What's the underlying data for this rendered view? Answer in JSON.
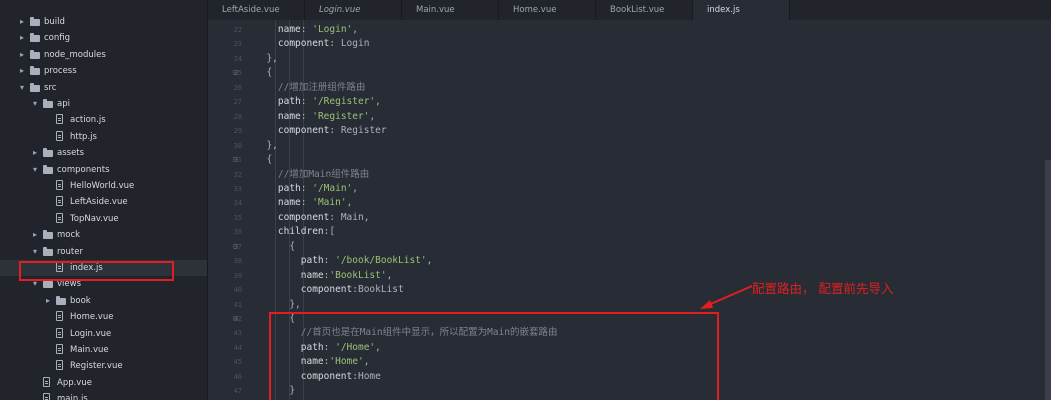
{
  "tree": [
    {
      "label": "build",
      "kind": "folder",
      "arrow": "collapsed",
      "depth": 0
    },
    {
      "label": "config",
      "kind": "folder",
      "arrow": "collapsed",
      "depth": 0
    },
    {
      "label": "node_modules",
      "kind": "folder",
      "arrow": "collapsed",
      "depth": 0
    },
    {
      "label": "process",
      "kind": "folder",
      "arrow": "collapsed",
      "depth": 0
    },
    {
      "label": "src",
      "kind": "folder",
      "arrow": "expanded",
      "depth": 0
    },
    {
      "label": "api",
      "kind": "folder",
      "arrow": "expanded",
      "depth": 1
    },
    {
      "label": "action.js",
      "kind": "file",
      "depth": 2
    },
    {
      "label": "http.js",
      "kind": "file",
      "depth": 2
    },
    {
      "label": "assets",
      "kind": "folder",
      "arrow": "collapsed",
      "depth": 1
    },
    {
      "label": "components",
      "kind": "folder",
      "arrow": "expanded",
      "depth": 1
    },
    {
      "label": "HelloWorld.vue",
      "kind": "file",
      "depth": 2
    },
    {
      "label": "LeftAside.vue",
      "kind": "file",
      "depth": 2
    },
    {
      "label": "TopNav.vue",
      "kind": "file",
      "depth": 2
    },
    {
      "label": "mock",
      "kind": "folder",
      "arrow": "collapsed",
      "depth": 1
    },
    {
      "label": "router",
      "kind": "folder",
      "arrow": "expanded",
      "depth": 1
    },
    {
      "label": "index.js",
      "kind": "file",
      "depth": 2,
      "selected": true
    },
    {
      "label": "views",
      "kind": "folder",
      "arrow": "expanded",
      "depth": 1
    },
    {
      "label": "book",
      "kind": "folder",
      "arrow": "collapsed",
      "depth": 2
    },
    {
      "label": "Home.vue",
      "kind": "file",
      "depth": 2
    },
    {
      "label": "Login.vue",
      "kind": "file",
      "depth": 2
    },
    {
      "label": "Main.vue",
      "kind": "file",
      "depth": 2
    },
    {
      "label": "Register.vue",
      "kind": "file",
      "depth": 2
    },
    {
      "label": "App.vue",
      "kind": "file",
      "depth": 1
    },
    {
      "label": "main.js",
      "kind": "file",
      "depth": 1
    }
  ],
  "tabs": [
    {
      "label": "LeftAside.vue",
      "italic": false,
      "active": false
    },
    {
      "label": "Login.vue",
      "italic": true,
      "active": false
    },
    {
      "label": "Main.vue",
      "italic": false,
      "active": false
    },
    {
      "label": "Home.vue",
      "italic": false,
      "active": false
    },
    {
      "label": "BookList.vue",
      "italic": false,
      "active": false
    },
    {
      "label": "index.js",
      "italic": false,
      "active": true
    }
  ],
  "lines": [
    {
      "n": "22",
      "fold": "",
      "tokens": [
        [
          "    ",
          "d"
        ],
        [
          "name",
          "k"
        ],
        [
          ": ",
          "p"
        ],
        [
          "'Login'",
          "s"
        ],
        [
          ",",
          "p"
        ]
      ]
    },
    {
      "n": "23",
      "fold": "",
      "tokens": [
        [
          "    ",
          "d"
        ],
        [
          "component",
          "k"
        ],
        [
          ": Login",
          "p"
        ]
      ]
    },
    {
      "n": "24",
      "fold": "",
      "tokens": [
        [
          "  },",
          "p"
        ]
      ]
    },
    {
      "n": "25",
      "fold": "⊟",
      "tokens": [
        [
          "  {",
          "p"
        ]
      ]
    },
    {
      "n": "26",
      "fold": "",
      "tokens": [
        [
          "    ",
          "d"
        ],
        [
          "//增加注册组件路由",
          "c"
        ]
      ]
    },
    {
      "n": "27",
      "fold": "",
      "tokens": [
        [
          "    ",
          "d"
        ],
        [
          "path",
          "k"
        ],
        [
          ": ",
          "p"
        ],
        [
          "'/Register'",
          "s"
        ],
        [
          ",",
          "p"
        ]
      ]
    },
    {
      "n": "28",
      "fold": "",
      "tokens": [
        [
          "    ",
          "d"
        ],
        [
          "name",
          "k"
        ],
        [
          ": ",
          "p"
        ],
        [
          "'Register'",
          "s"
        ],
        [
          ",",
          "p"
        ]
      ]
    },
    {
      "n": "29",
      "fold": "",
      "tokens": [
        [
          "    ",
          "d"
        ],
        [
          "component",
          "k"
        ],
        [
          ": Register",
          "p"
        ]
      ]
    },
    {
      "n": "30",
      "fold": "",
      "tokens": [
        [
          "  },",
          "p"
        ]
      ]
    },
    {
      "n": "31",
      "fold": "⊟",
      "tokens": [
        [
          "  {",
          "p"
        ]
      ]
    },
    {
      "n": "32",
      "fold": "",
      "tokens": [
        [
          "    ",
          "d"
        ],
        [
          "//增加Main组件路由",
          "c"
        ]
      ]
    },
    {
      "n": "33",
      "fold": "",
      "tokens": [
        [
          "    ",
          "d"
        ],
        [
          "path",
          "k"
        ],
        [
          ": ",
          "p"
        ],
        [
          "'/Main'",
          "s"
        ],
        [
          ",",
          "p"
        ]
      ]
    },
    {
      "n": "34",
      "fold": "",
      "tokens": [
        [
          "    ",
          "d"
        ],
        [
          "name",
          "k"
        ],
        [
          ": ",
          "p"
        ],
        [
          "'Main'",
          "s"
        ],
        [
          ",",
          "p"
        ]
      ]
    },
    {
      "n": "35",
      "fold": "",
      "tokens": [
        [
          "    ",
          "d"
        ],
        [
          "component",
          "k"
        ],
        [
          ": Main,",
          "p"
        ]
      ]
    },
    {
      "n": "36",
      "fold": "",
      "tokens": [
        [
          "    ",
          "d"
        ],
        [
          "children",
          "k"
        ],
        [
          ":[",
          "p"
        ]
      ]
    },
    {
      "n": "37",
      "fold": "⊟",
      "tokens": [
        [
          "      {",
          "p"
        ]
      ]
    },
    {
      "n": "38",
      "fold": "",
      "tokens": [
        [
          "        ",
          "d"
        ],
        [
          "path",
          "k"
        ],
        [
          ": ",
          "p"
        ],
        [
          "'/book/BookList'",
          "s"
        ],
        [
          ",",
          "p"
        ]
      ]
    },
    {
      "n": "39",
      "fold": "",
      "tokens": [
        [
          "        ",
          "d"
        ],
        [
          "name",
          "k"
        ],
        [
          ":",
          "p"
        ],
        [
          "'BookList'",
          "s"
        ],
        [
          ",",
          "p"
        ]
      ]
    },
    {
      "n": "40",
      "fold": "",
      "tokens": [
        [
          "        ",
          "d"
        ],
        [
          "component",
          "k"
        ],
        [
          ":BookList",
          "p"
        ]
      ]
    },
    {
      "n": "41",
      "fold": "",
      "tokens": [
        [
          "      },",
          "p"
        ]
      ]
    },
    {
      "n": "42",
      "fold": "⊟",
      "tokens": [
        [
          "      {",
          "p"
        ]
      ]
    },
    {
      "n": "43",
      "fold": "",
      "tokens": [
        [
          "        ",
          "d"
        ],
        [
          "//首页也是在Main组件中显示，所以配置为Main的嵌套路由",
          "c"
        ]
      ]
    },
    {
      "n": "44",
      "fold": "",
      "tokens": [
        [
          "        ",
          "d"
        ],
        [
          "path",
          "k"
        ],
        [
          ": ",
          "p"
        ],
        [
          "'/Home'",
          "s"
        ],
        [
          ",",
          "p"
        ]
      ]
    },
    {
      "n": "45",
      "fold": "",
      "tokens": [
        [
          "        ",
          "d"
        ],
        [
          "name",
          "k"
        ],
        [
          ":",
          "p"
        ],
        [
          "'Home'",
          "s"
        ],
        [
          ",",
          "p"
        ]
      ]
    },
    {
      "n": "46",
      "fold": "",
      "tokens": [
        [
          "        ",
          "d"
        ],
        [
          "component",
          "k"
        ],
        [
          ":Home",
          "p"
        ]
      ]
    },
    {
      "n": "47",
      "fold": "",
      "tokens": [
        [
          "      }",
          "p"
        ]
      ]
    }
  ],
  "annotation": {
    "text": "配置路由， 配置前先导入"
  },
  "colors": {
    "highlight": "#e02020",
    "string": "#98c379",
    "comment": "#7f848e"
  }
}
